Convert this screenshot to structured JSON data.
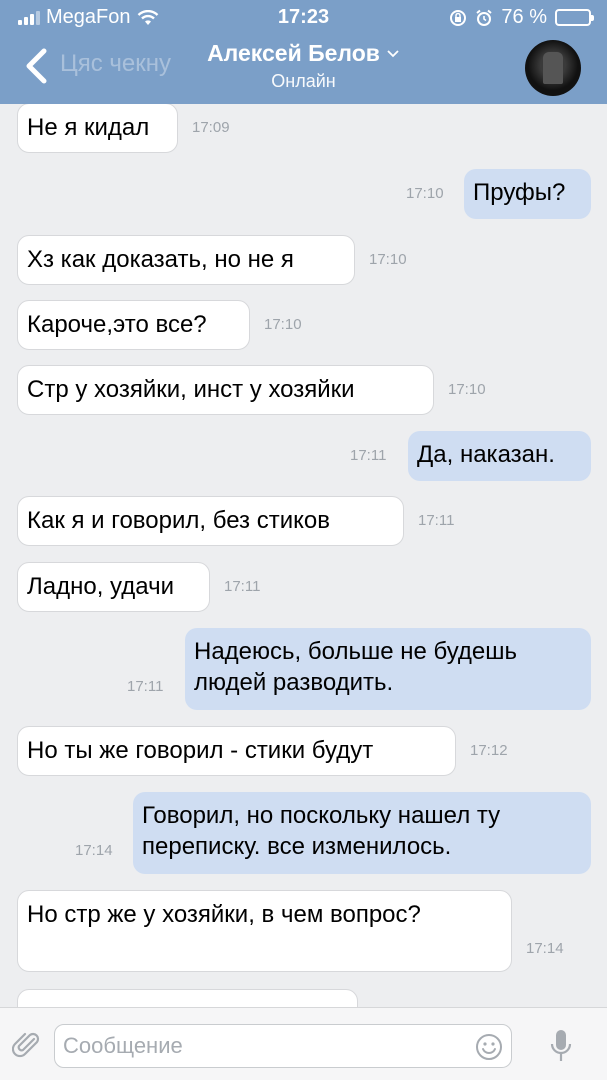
{
  "status_bar": {
    "carrier": "MegaFon",
    "time": "17:23",
    "battery_percent": "76 %",
    "battery_level": 0.76
  },
  "header": {
    "back_label": "Цяс чекну",
    "contact_name": "Алексей Белов",
    "contact_status": "Онлайн"
  },
  "messages": [
    {
      "dir": "in",
      "text": "Не я кидал",
      "time": "17:09"
    },
    {
      "dir": "out",
      "text": "Пруфы?",
      "time": "17:10"
    },
    {
      "dir": "in",
      "text": "Хз как доказать, но не я",
      "time": "17:10"
    },
    {
      "dir": "in",
      "text": "Кароче,это все?",
      "time": "17:10"
    },
    {
      "dir": "in",
      "text": "Стр у хозяйки, инст у хозяйки",
      "time": "17:10"
    },
    {
      "dir": "out",
      "text": "Да, наказан.",
      "time": "17:11"
    },
    {
      "dir": "in",
      "text": "Как я и говорил, без стиков",
      "time": "17:11"
    },
    {
      "dir": "in",
      "text": "Ладно, удачи",
      "time": "17:11"
    },
    {
      "dir": "out",
      "text": "Надеюсь, больше не будешь\nлюдей разводить.",
      "time": "17:11"
    },
    {
      "dir": "in",
      "text": "Но ты же говорил - стики будут",
      "time": "17:12"
    },
    {
      "dir": "out",
      "text": "Говорил, но поскольку нашел ту\nпереписку. все изменилось.",
      "time": "17:14"
    },
    {
      "dir": "in",
      "text": "Но стр же у хозяйки, в чем вопрос?",
      "time": "17:14"
    }
  ],
  "input": {
    "placeholder": "Сообщение"
  },
  "colors": {
    "header": "#7b9fc8",
    "background": "#edeef0",
    "incoming_bubble": "#ffffff",
    "outgoing_bubble": "#cfddf2"
  }
}
